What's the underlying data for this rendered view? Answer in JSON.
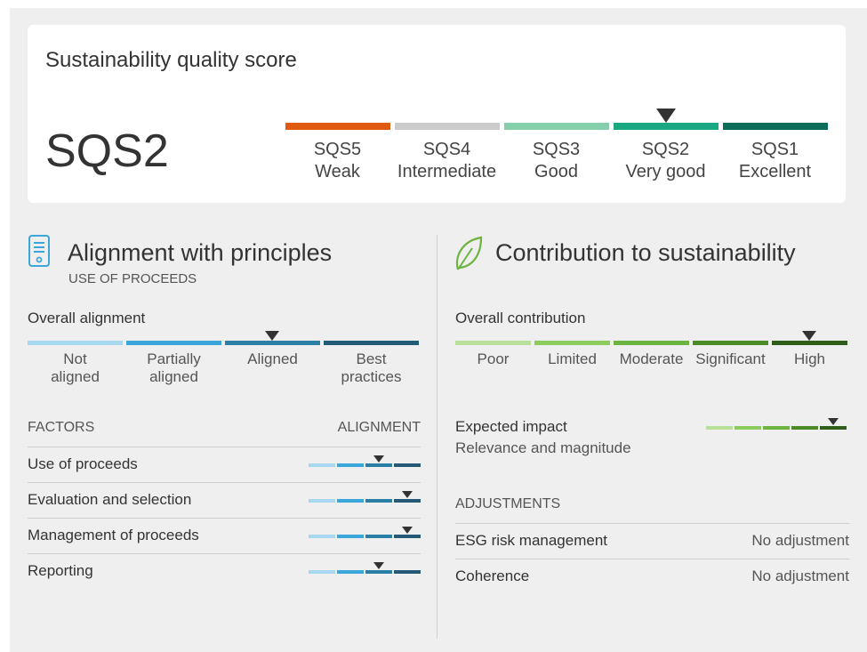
{
  "score_card": {
    "title": "Sustainability quality score",
    "score": "SQS2",
    "scale": [
      {
        "code": "SQS5",
        "label": "Weak",
        "color": "#e05a12"
      },
      {
        "code": "SQS4",
        "label": "Intermediate",
        "color": "#cccccc"
      },
      {
        "code": "SQS3",
        "label": "Good",
        "color": "#86cfac"
      },
      {
        "code": "SQS2",
        "label": "Very good",
        "color": "#1aa883"
      },
      {
        "code": "SQS1",
        "label": "Excellent",
        "color": "#0b6e5a"
      }
    ],
    "selected_index": 3
  },
  "alignment": {
    "icon": "document-icon",
    "title": "Alignment with principles",
    "subtitle": "USE OF PROCEEDS",
    "overall_label": "Overall alignment",
    "levels": [
      "Not aligned",
      "Partially aligned",
      "Aligned",
      "Best practices"
    ],
    "level_lines": [
      [
        "Not",
        "aligned"
      ],
      [
        "Partially",
        "aligned"
      ],
      [
        "Aligned",
        ""
      ],
      [
        "Best",
        "practices"
      ]
    ],
    "colors": [
      "#a7d8ef",
      "#3aa6d9",
      "#2b7fa6",
      "#235b77"
    ],
    "overall_index": 2,
    "factors_header": "FACTORS",
    "alignment_header": "ALIGNMENT",
    "factors": [
      {
        "name": "Use of proceeds",
        "index": 2
      },
      {
        "name": "Evaluation and selection",
        "index": 3
      },
      {
        "name": "Management of proceeds",
        "index": 3
      },
      {
        "name": "Reporting",
        "index": 2
      }
    ]
  },
  "contribution": {
    "icon": "leaf-icon",
    "title": "Contribution to sustainability",
    "overall_label": "Overall contribution",
    "levels": [
      "Poor",
      "Limited",
      "Moderate",
      "Significant",
      "High"
    ],
    "colors": [
      "#b9e09a",
      "#8ccc5c",
      "#6cb33f",
      "#4a8b27",
      "#2f5d1a"
    ],
    "overall_index": 4,
    "expected_impact_label": "Expected impact",
    "expected_impact_sub": "Relevance and magnitude",
    "expected_impact_index": 4,
    "adjustments_header": "ADJUSTMENTS",
    "adjustments": [
      {
        "name": "ESG risk management",
        "value": "No adjustment"
      },
      {
        "name": "Coherence",
        "value": "No adjustment"
      }
    ]
  }
}
